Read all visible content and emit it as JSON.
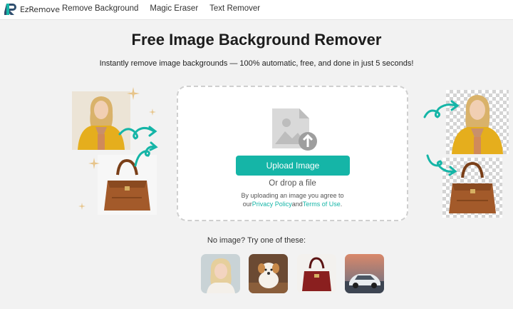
{
  "header": {
    "logo_text": "EzRemove",
    "nav": [
      "Remove Background",
      "Magic Eraser",
      "Text Remover"
    ]
  },
  "hero": {
    "title": "Free Image Background Remover",
    "subtitle": "Instantly remove image backgrounds — 100% automatic, free, and done in just 5 seconds!"
  },
  "upload": {
    "button_label": "Upload Image",
    "drop_text": "Or drop a file",
    "terms_prefix": "By uploading an image you agree to",
    "terms_our": "our",
    "privacy_link": "Privacy Policy",
    "and": "and",
    "terms_link": "Terms of Use",
    "period": "."
  },
  "samples": {
    "label": "No image? Try one of these:",
    "items": [
      "woman",
      "puppy",
      "red-handbag",
      "car"
    ]
  },
  "colors": {
    "accent": "#15b5a7",
    "background": "#f2f2f2",
    "jacket": "#e7b52a",
    "bag": "#a35a2a"
  }
}
